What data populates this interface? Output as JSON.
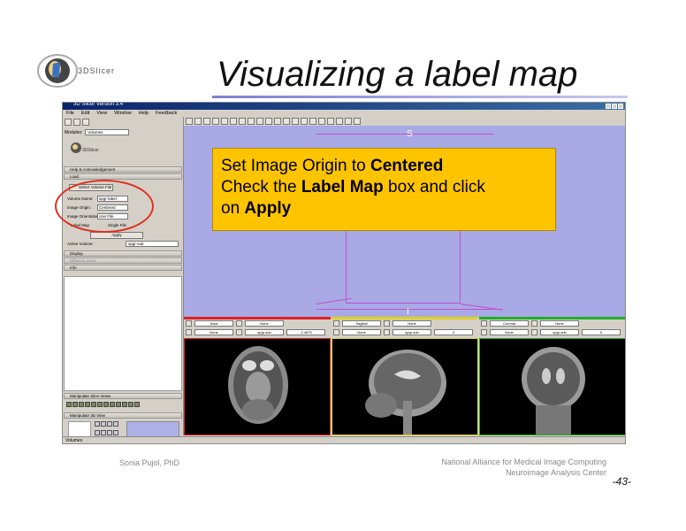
{
  "logo": {
    "text": "3DSlicer"
  },
  "title": "Visualizing a label map",
  "window": {
    "title": "3D Slicer Version 3.4",
    "menu": [
      "File",
      "Edit",
      "View",
      "Window",
      "Help",
      "Feedback"
    ]
  },
  "left_panel": {
    "modules_label": "Modules:",
    "module_value": "Volumes",
    "logo_text": "3DSlicer",
    "sections": {
      "help": "Help & Acknowledgement",
      "load": "Load",
      "display": "Display",
      "diffusion": "Diffusion Lines",
      "info": "Info",
      "manip_slice": "Manipulate Slice Views",
      "manip_3d": "Manipulate 3D View"
    },
    "load_button": "Select Volume File",
    "volume_name_label": "Volume Name:",
    "volume_name_value": "spgr-label",
    "image_origin_label": "Image Origin:",
    "image_origin_value": "Centered",
    "image_orientation_label": "Image Orientation:",
    "image_orientation_value": "Use File",
    "label_map_label": "Label Map",
    "single_file_label": "Single File",
    "apply_label": "Apply",
    "active_volume_label": "Active Volume:",
    "active_volume_value": "spgr-sub"
  },
  "views": {
    "top_label": "S",
    "bottom_label": "I",
    "slices": [
      {
        "color": "#e02020",
        "orient": "Axial",
        "fg": "None",
        "vol": "spgr-sub",
        "offset": "-2.4875"
      },
      {
        "color": "#e0d020",
        "orient": "Sagittal",
        "fg": "None",
        "vol": "spgr-sub",
        "offset": "0"
      },
      {
        "color": "#20b020",
        "orient": "Coronal",
        "fg": "None",
        "vol": "spgr-sub",
        "offset": "0"
      }
    ]
  },
  "status": "Volumes",
  "callout": {
    "line1_prefix": "Set Image Origin to ",
    "line1_bold": "Centered",
    "line2_prefix": "Check the ",
    "line2_bold": "Label Map",
    "line2_suffix": " box and click",
    "line3_prefix": "on ",
    "line3_bold": "Apply"
  },
  "footer": {
    "author": "Sonia Pujol, PhD",
    "org1": "National Alliance for Medical Image Computing",
    "org2": "Neuroimage Analysis Center",
    "page": "-43-"
  },
  "colors": {
    "title_rule": "#7f7fd0",
    "callout_bg": "#ffc400",
    "view_bg": "#a9a9e6",
    "ellipse": "#e03020"
  }
}
